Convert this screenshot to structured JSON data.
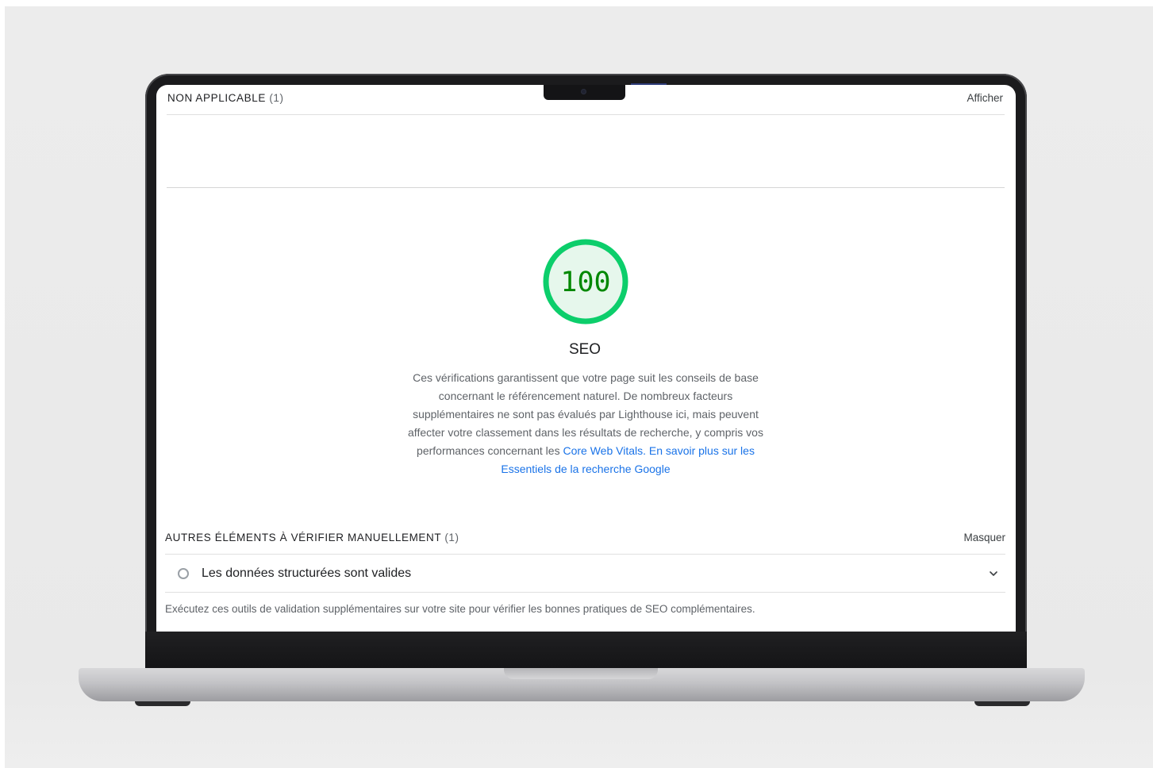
{
  "non_applicable": {
    "label": "NON APPLICABLE",
    "count": "(1)",
    "toggle": "Afficher"
  },
  "category": {
    "score": "100",
    "score_value": 100,
    "title": "SEO",
    "gauge_color": "#0cce6b",
    "gauge_fill": "#e6f7ec",
    "score_text_color": "#008800",
    "description_part1": "Ces vérifications garantissent que votre page suit les conseils de base concernant le référencement naturel. De nombreux facteurs supplémentaires ne sont pas évalués par Lighthouse ici, mais peuvent affecter votre classement dans les résultats de recherche, y compris vos performances concernant les ",
    "link_core_web_vitals": "Core Web Vitals",
    "separator": ". ",
    "link_learn_more": "En savoir plus sur les Essentiels de la recherche Google",
    "link_color": "#1a73e8"
  },
  "manual": {
    "label": "AUTRES ÉLÉMENTS À VÉRIFIER MANUELLEMENT",
    "count": "(1)",
    "toggle": "Masquer",
    "audits": [
      {
        "title": "Les données structurées sont valides",
        "icon": "circle-outline-icon"
      }
    ],
    "footnote": "Exécutez ces outils de validation supplémentaires sur votre site pour vérifier les bonnes pratiques de SEO complémentaires."
  }
}
